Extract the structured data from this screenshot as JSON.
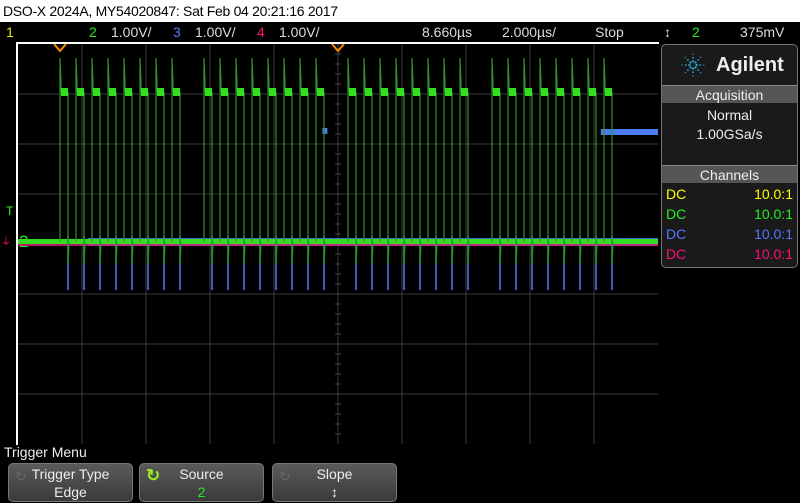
{
  "title": "DSO-X 2024A, MY54020847: Sat Feb 04 20:21:16 2017",
  "topbar": {
    "ch1": "1",
    "ch2": "2",
    "ch2_scale": "1.00V/",
    "ch3": "3",
    "ch3_scale": "1.00V/",
    "ch4": "4",
    "ch4_scale": "1.00V/",
    "delay": "8.660µs",
    "timebase": "2.000µs/",
    "run_state": "Stop",
    "trigger_slope_icon": "↕",
    "trigger_source": "2",
    "trigger_level": "375mV"
  },
  "markers": {
    "trigger": "T",
    "ch2": "2"
  },
  "panel": {
    "brand": "Agilent",
    "acquisition_header": "Acquisition",
    "mode": "Normal",
    "rate": "1.00GSa/s",
    "channels_header": "Channels",
    "channels": [
      {
        "coupling": "DC",
        "probe": "10.0:1",
        "color": "#ffff00"
      },
      {
        "coupling": "DC",
        "probe": "10.0:1",
        "color": "#22ee22"
      },
      {
        "coupling": "DC",
        "probe": "10.0:1",
        "color": "#5577ff"
      },
      {
        "coupling": "DC",
        "probe": "10.0:1",
        "color": "#ff1177"
      }
    ]
  },
  "menu": {
    "title": "Trigger Menu",
    "softkeys": [
      {
        "label": "Trigger Type",
        "value": "Edge"
      },
      {
        "label": "Source",
        "value": "2"
      },
      {
        "label": "Slope",
        "value": "↕"
      }
    ]
  },
  "chart_data": {
    "type": "line",
    "x_unit": "µs after trigger",
    "time_per_div_us": 2.0,
    "volts_per_div": 1.0,
    "ch2_pulse_groups_start_us": [
      0,
      4.5,
      9.0,
      13.5
    ],
    "pulses_per_group": 8,
    "pulse_period_us": 0.5,
    "pulse_width_us": 0.25,
    "ch2_high_v": 3.0,
    "ch3_step_time_us": 16.9,
    "ch3_step_level_v": 2.2
  }
}
